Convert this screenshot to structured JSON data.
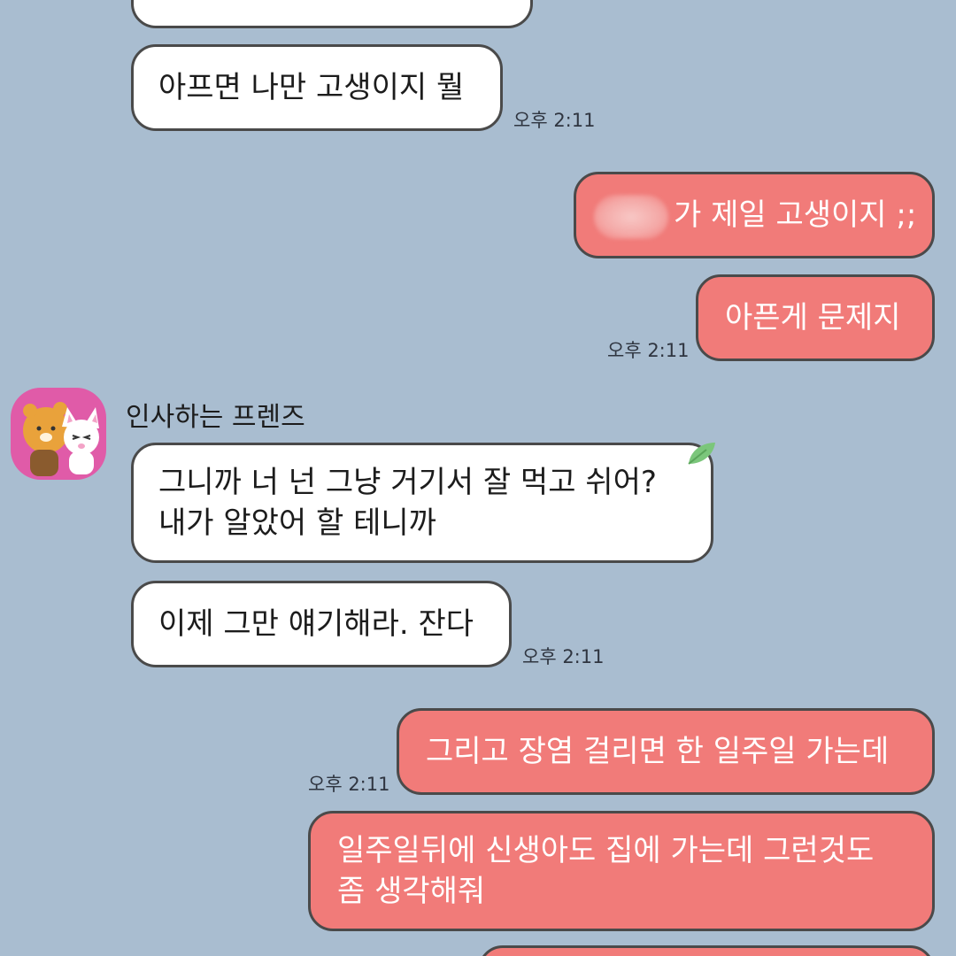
{
  "messages": [
    {
      "id": "m0",
      "side": "in",
      "text": ""
    },
    {
      "id": "m1",
      "side": "in",
      "text": "아프면 나만 고생이지 뭘",
      "time": "오후 2:11"
    },
    {
      "id": "m2",
      "side": "out",
      "text": "가 제일 고생이지 ;;"
    },
    {
      "id": "m3",
      "side": "out",
      "text": "아픈게 문제지",
      "time": "오후 2:11"
    },
    {
      "id": "m4",
      "side": "in",
      "lines": [
        "그니까 너 넌 그냥 거기서 잘 먹고 쉬어?",
        "내가 알았어 할 테니까"
      ]
    },
    {
      "id": "m5",
      "side": "in",
      "text": "이제 그만 얘기해라. 잔다",
      "time": "오후 2:11"
    },
    {
      "id": "m6",
      "side": "out",
      "text": "그리고 장염 걸리면 한 일주일 가는데",
      "time": "오후 2:11"
    },
    {
      "id": "m7",
      "side": "out",
      "lines": [
        "일주일뒤에 신생아도 집에 가는데 그런것도",
        "좀 생각해줘"
      ]
    }
  ],
  "sender": {
    "name": "인사하는 프렌즈",
    "avatar_icon": "friends-avatar-icon"
  },
  "colors": {
    "background": "#a9bdd0",
    "incoming_bubble": "#ffffff",
    "outgoing_bubble": "#f17b79"
  }
}
